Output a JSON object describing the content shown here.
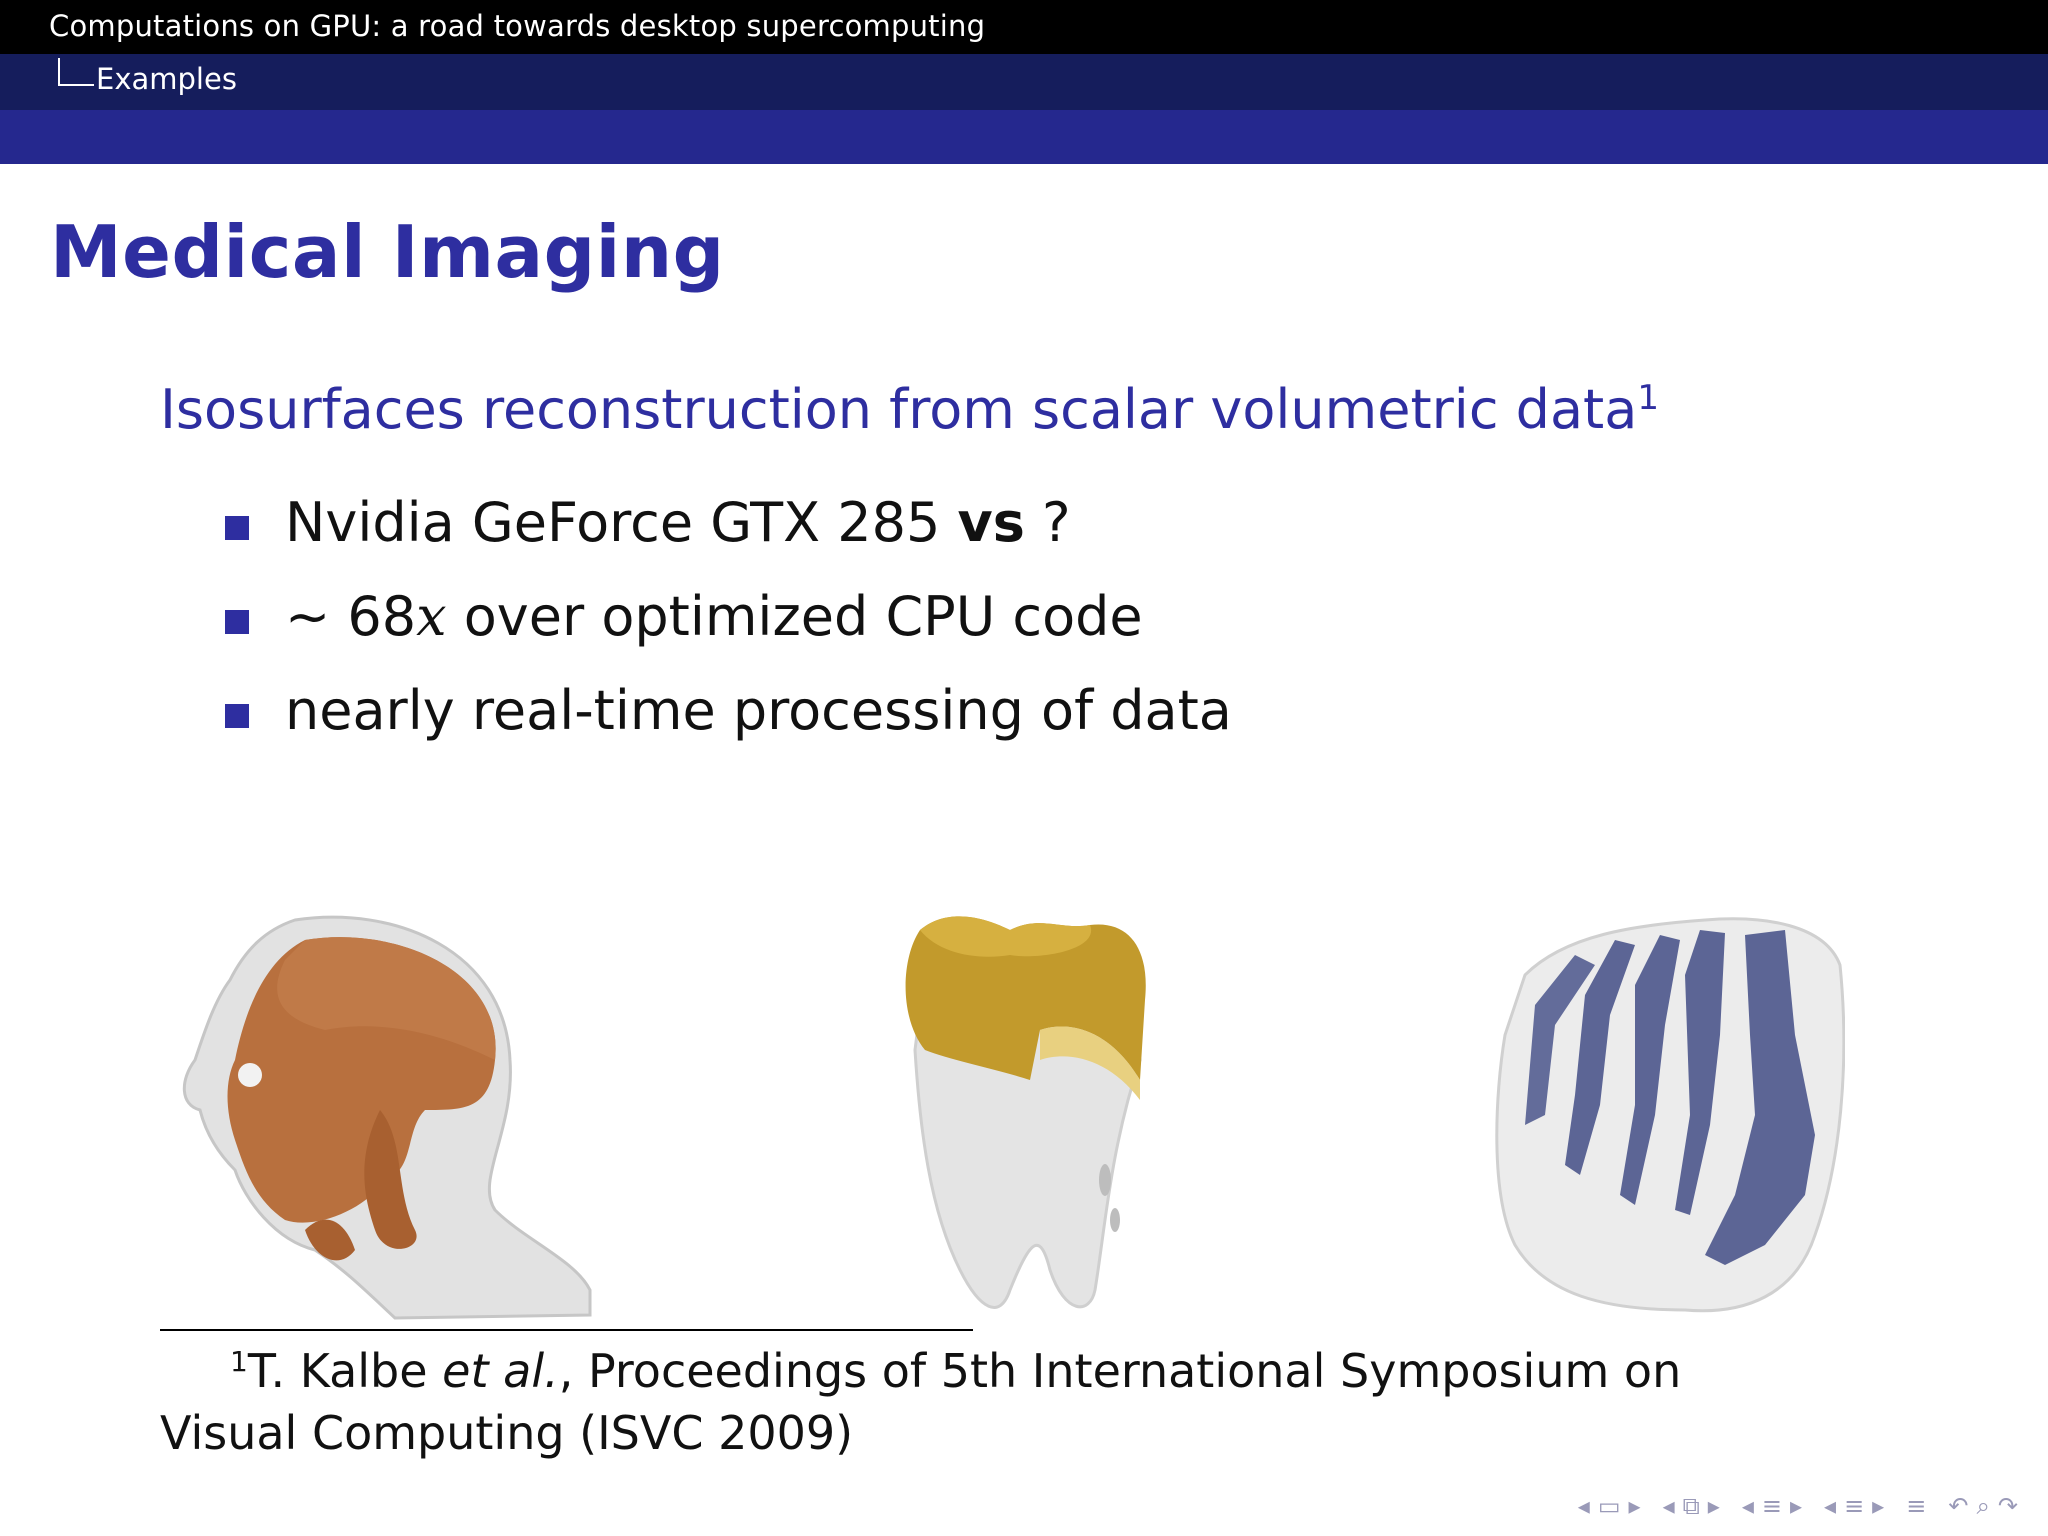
{
  "header": {
    "title": "Computations on GPU: a road towards desktop supercomputing",
    "section": "Examples"
  },
  "frame_title": "Medical Imaging",
  "block": {
    "title": "Isosurfaces reconstruction from scalar volumetric data",
    "footnote_mark": "1"
  },
  "bullets": [
    {
      "text": "Nvidia GeForce GTX 285 ",
      "bold": "vs",
      "tail": " ?"
    },
    {
      "prefix": "∼ 68",
      "italic": "x",
      "text": " over optimized CPU code"
    },
    {
      "text": "nearly real-time processing of data"
    }
  ],
  "footnote": {
    "mark": "1",
    "author": "T. Kalbe ",
    "etal": "et al.",
    "rest": ", Proceedings of 5th International Symposium on Visual Computing (ISVC 2009)"
  },
  "images": [
    {
      "name": "head-skull-isosurface",
      "colors": [
        "#b06a3a",
        "#dcdcdc"
      ]
    },
    {
      "name": "tooth-isosurface",
      "colors": [
        "#c8a030",
        "#e0e0e0"
      ]
    },
    {
      "name": "foot-bones-isosurface",
      "colors": [
        "#606a98",
        "#e6e6e6"
      ]
    }
  ],
  "nav_icons": [
    "arrow-left-icon",
    "frame-icon",
    "arrow-right-icon",
    "arrow-left-icon",
    "subsection-icon",
    "arrow-right-icon",
    "arrow-left-icon",
    "section-icon",
    "arrow-right-icon",
    "arrow-left-icon",
    "presentation-icon",
    "arrow-right-icon",
    "align-icon",
    "undo-icon",
    "search-icon",
    "redo-icon"
  ]
}
